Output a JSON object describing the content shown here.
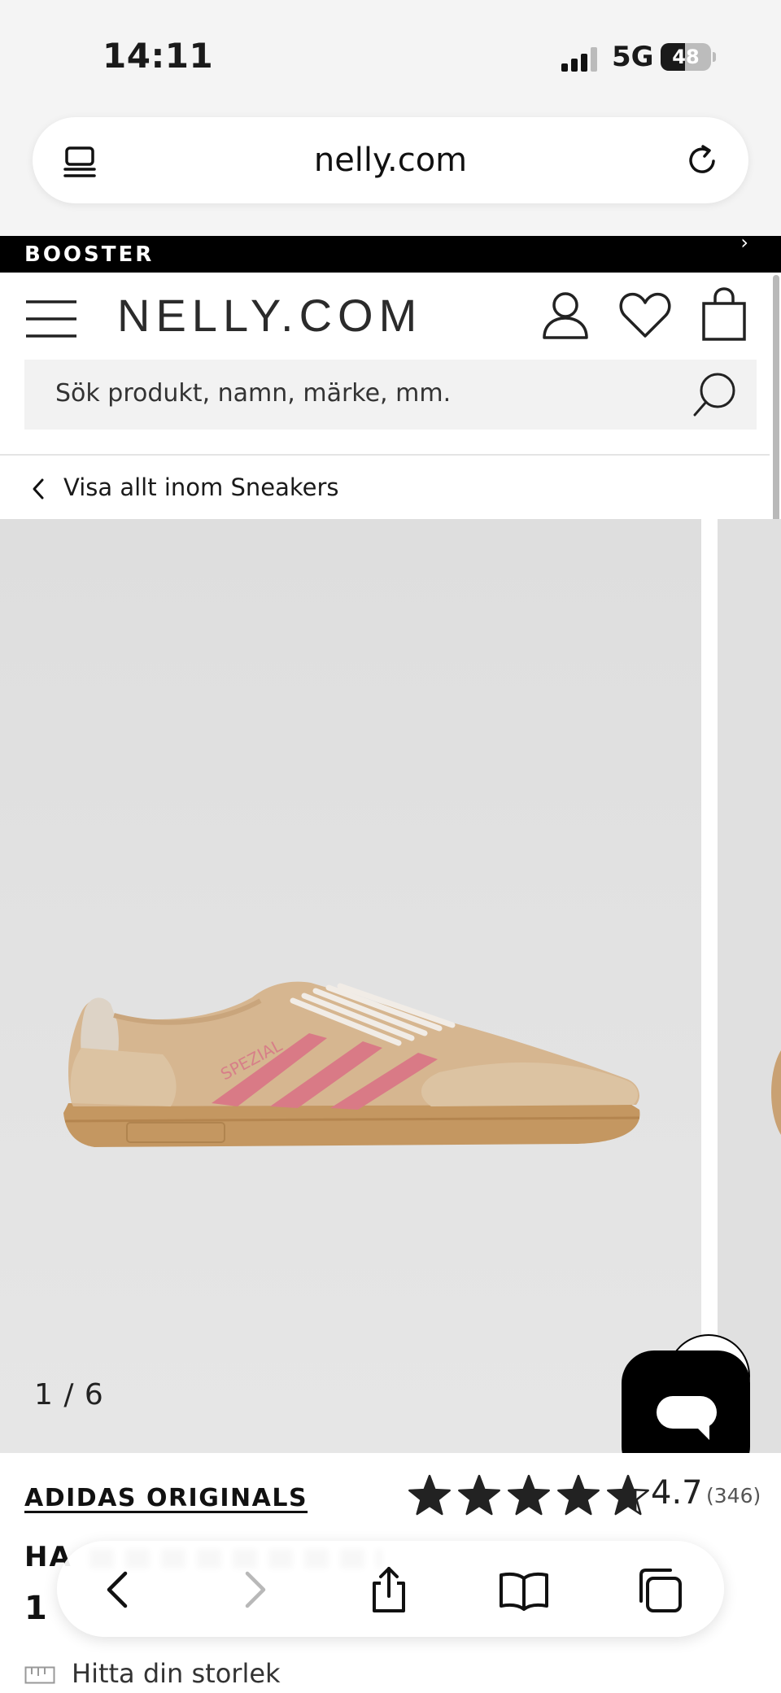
{
  "status_bar": {
    "time": "14:11",
    "network": "5G",
    "battery": "48",
    "battery_level": 0.48
  },
  "browser": {
    "url": "nelly.com"
  },
  "promo": {
    "text": "BOOSTER"
  },
  "header": {
    "logo": "NELLY.COM"
  },
  "search": {
    "placeholder": "Sök produkt, namn, märke, mm."
  },
  "breadcrumb": {
    "back_label": "Visa allt inom Sneakers"
  },
  "gallery": {
    "counter": "1 / 6"
  },
  "product": {
    "brand": "ADIDAS ORIGINALS",
    "rating": "4.7",
    "rating_value": 4.7,
    "rating_count": "(346)",
    "name_partial": "HA",
    "price_partial": "1",
    "size_guide_label": "Hitta din storlek"
  },
  "icons": {
    "tabs": "tabs-overview-icon",
    "reload": "reload-icon",
    "menu": "hamburger-menu-icon",
    "account": "account-icon",
    "wishlist": "heart-icon",
    "bag": "shopping-bag-icon",
    "search": "search-icon",
    "chat": "chat-icon",
    "back": "back-arrow-icon",
    "forward": "forward-arrow-icon",
    "share": "share-icon",
    "bookmarks": "bookmarks-icon",
    "tabs_bottom": "tabs-icon"
  },
  "colors": {
    "accent": "#000000",
    "shoe_stripes": "#d97a86",
    "shoe_upper": "#d6b690",
    "sole": "#c69a62"
  }
}
